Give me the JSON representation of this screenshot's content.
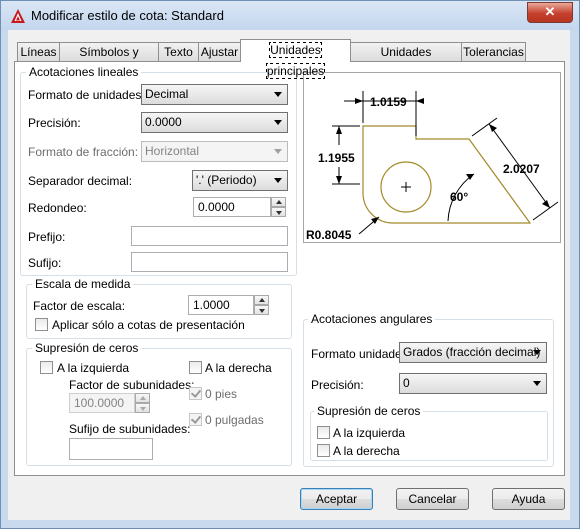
{
  "window": {
    "title": "Modificar estilo de cota: Standard",
    "close_glyph": "✕"
  },
  "tabs": [
    {
      "label": "Líneas"
    },
    {
      "label": "Símbolos y flechas"
    },
    {
      "label": "Texto"
    },
    {
      "label": "Ajustar"
    },
    {
      "label": "Unidades principales"
    },
    {
      "label": "Unidades alternativas"
    },
    {
      "label": "Tolerancias"
    }
  ],
  "active_tab": "Unidades principales",
  "linear": {
    "legend": "Acotaciones lineales",
    "unit_format_label": "Formato de unidades:",
    "unit_format_value": "Decimal",
    "precision_label": "Precisión:",
    "precision_value": "0.0000",
    "fraction_format_label": "Formato de fracción:",
    "fraction_format_value": "Horizontal",
    "decimal_sep_label": "Separador decimal:",
    "decimal_sep_value": "'.' (Periodo)",
    "round_label": "Redondeo:",
    "round_value": "0.0000",
    "prefix_label": "Prefijo:",
    "prefix_value": "",
    "suffix_label": "Sufijo:",
    "suffix_value": ""
  },
  "scale": {
    "legend": "Escala de medida",
    "factor_label": "Factor de escala:",
    "factor_value": "1.0000",
    "layout_only_label": "Aplicar sólo a cotas de presentación",
    "layout_only_checked": false
  },
  "zeros_linear": {
    "legend": "Supresión de ceros",
    "leading_label": "A la izquierda",
    "trailing_label": "A la derecha",
    "subunit_factor_label": "Factor de subunidades:",
    "subunit_factor_value": "100.0000",
    "subunit_suffix_label": "Sufijo de subunidades:",
    "subunit_suffix_value": "",
    "feet_label": "0 pies",
    "inches_label": "0 pulgadas"
  },
  "preview": {
    "dim_top": "1.0159",
    "dim_left": "1.1955",
    "dim_right": "2.0207",
    "dim_angle": "60°",
    "dim_radius": "R0.8045",
    "colors": {
      "geometry": "#a38a2a",
      "dimension": "#000000"
    }
  },
  "angular": {
    "legend": "Acotaciones angulares",
    "format_label": "Formato unidades:",
    "format_value": "Grados (fracción decimal)",
    "precision_label": "Precisión:",
    "precision_value": "0",
    "zeros_legend": "Supresión de ceros",
    "leading_label": "A la izquierda",
    "trailing_label": "A la derecha"
  },
  "buttons": {
    "ok": "Aceptar",
    "cancel": "Cancelar",
    "help": "Ayuda"
  }
}
